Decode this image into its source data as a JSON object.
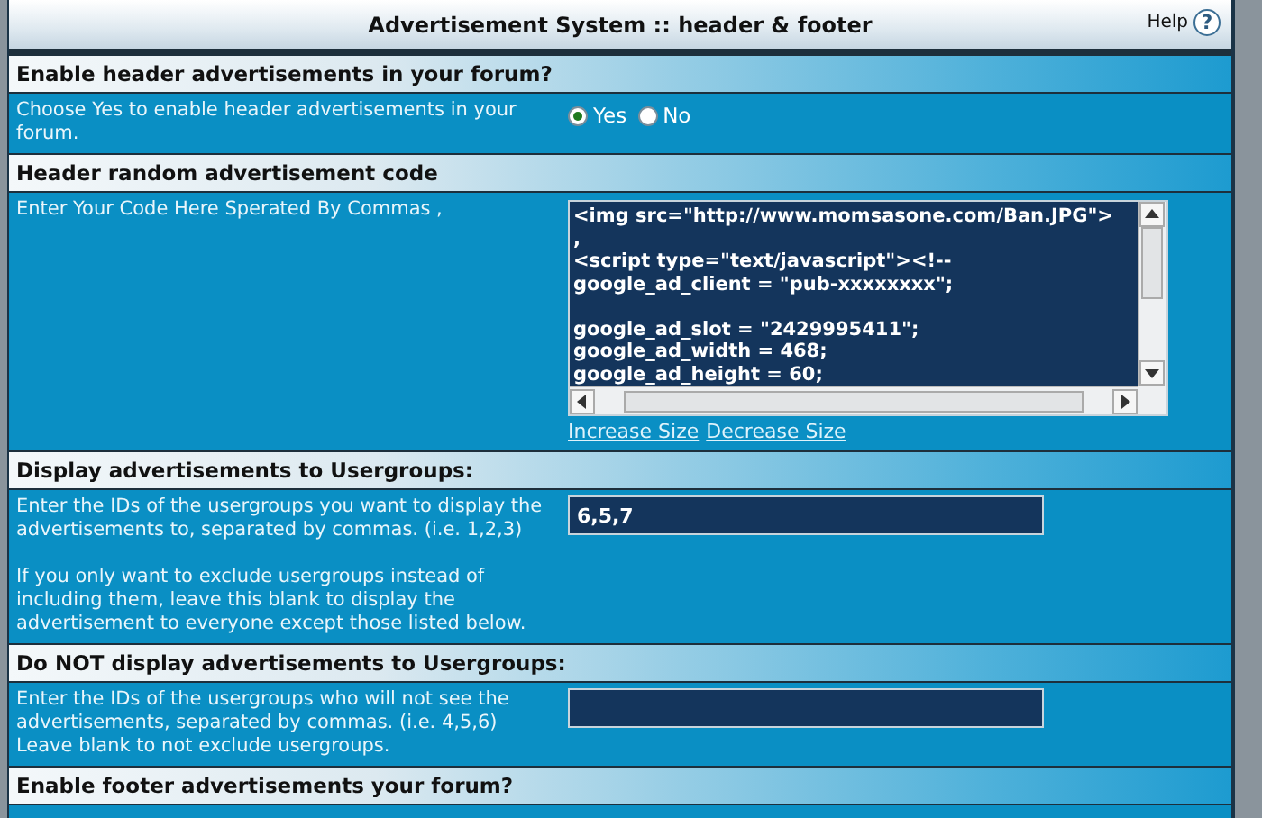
{
  "window": {
    "title": "Advertisement System :: header & footer",
    "help": "Help",
    "help_icon": "?"
  },
  "sections": [
    {
      "heading": "Enable header advertisements in your forum?",
      "description": [
        "Choose Yes to enable header advertisements in your forum."
      ],
      "control": {
        "kind": "radio",
        "options": [
          {
            "label": "Yes",
            "selected": true
          },
          {
            "label": "No",
            "selected": false
          }
        ]
      }
    },
    {
      "heading": "Header random advertisement code",
      "description": [
        "Enter Your Code Here Sperated By Commas ,"
      ],
      "control": {
        "kind": "code",
        "value": "<img src=\"http://www.momsasone.com/Ban.JPG\">\n,\n<script type=\"text/javascript\"><!--\ngoogle_ad_client = \"pub-xxxxxxxx\";\n\ngoogle_ad_slot = \"2429995411\";\ngoogle_ad_width = 468;\ngoogle_ad_height = 60;",
        "links": [
          "Increase Size",
          "Decrease Size"
        ]
      }
    },
    {
      "heading": "Display advertisements to Usergroups:",
      "description": [
        "Enter the IDs of the usergroups you want to display the advertisements to, separated by commas. (i.e. 1,2,3)",
        "If you only want to exclude usergroups instead of including them, leave this blank to display the advertisement to everyone except those listed below."
      ],
      "control": {
        "kind": "text",
        "value": "6,5,7"
      }
    },
    {
      "heading": "Do NOT display advertisements to Usergroups:",
      "description": [
        "Enter the IDs of the usergroups who will not see the advertisements, separated by commas. (i.e. 4,5,6) Leave blank to not exclude usergroups."
      ],
      "control": {
        "kind": "text"
      }
    },
    {
      "heading": "Enable footer advertisements your forum?"
    }
  ]
}
